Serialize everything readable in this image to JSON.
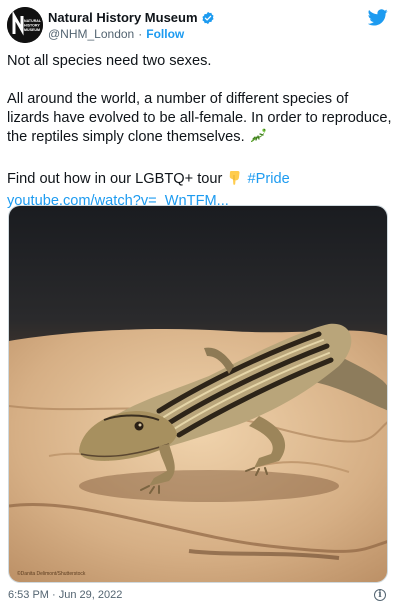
{
  "tweet": {
    "author": {
      "display_name": "Natural History Museum",
      "handle": "@NHM_London",
      "separator": "·",
      "follow_label": "Follow",
      "verified": true,
      "avatar_text": [
        "NATURAL",
        "HISTORY",
        "MUSEUM"
      ]
    },
    "text": {
      "para1": "Not all species need two sexes.",
      "para2": "All around the world, a number of different species of lizards have evolved to be all-female. In order to reproduce, the reptiles simply clone themselves.",
      "para3_text": "Find out how in our LGBTQ+ tour",
      "hashtag": "#Pride",
      "link": "youtube.com/watch?v=_WnTFM..."
    },
    "media": {
      "credit": "©Danita Delimont/Shutterstock"
    },
    "timestamp": "6:53 PM · Jun 29, 2022",
    "info_symbol": "i"
  },
  "colors": {
    "accent": "#1d9bf0",
    "text": "#0f1419",
    "muted": "#536471"
  },
  "icons": {
    "verified": "verified-badge-icon",
    "bird": "twitter-bird-icon",
    "lizard_emoji": "lizard-emoji-icon",
    "pointing_down_emoji": "backhand-index-pointing-down-icon",
    "info": "info-icon"
  }
}
